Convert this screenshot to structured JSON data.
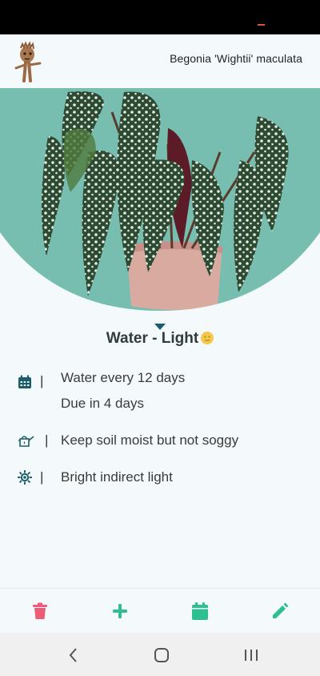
{
  "header": {
    "plant_name": "Begonia 'Wightii' maculata",
    "logo_icon": "groot-mascot-icon"
  },
  "section": {
    "title": "Water - Light",
    "arrow_icon": "caret-down-icon",
    "emoji_icon": "smiley-emoji-icon"
  },
  "care": {
    "water": {
      "icon": "calendar-icon",
      "line1": "Water every 12 days",
      "line2": "Due in 4 days"
    },
    "soil": {
      "icon": "watering-can-icon",
      "text": "Keep soil moist but not soggy"
    },
    "light": {
      "icon": "sun-icon",
      "text": "Bright indirect light"
    },
    "separator": "|"
  },
  "toolbar": {
    "delete_icon": "trash-icon",
    "add_icon": "plus-icon",
    "calendar_icon": "calendar-icon",
    "edit_icon": "pencil-icon"
  },
  "nav": {
    "back_icon": "back-chevron-icon",
    "home_icon": "home-icon",
    "recents_icon": "recents-icon"
  },
  "colors": {
    "accent_teal": "#1b5e6a",
    "delete_red": "#ef5a79",
    "action_green": "#2ebf91"
  }
}
